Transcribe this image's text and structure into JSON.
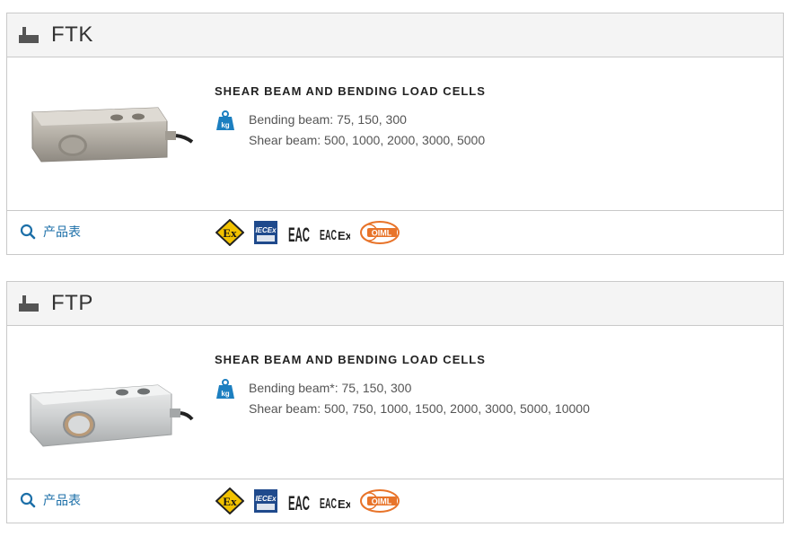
{
  "products": [
    {
      "code": "FTK",
      "category": "SHEAR BEAM AND BENDING LOAD CELLS",
      "unit_icon_label": "kg",
      "specs": [
        "Bending beam: 75, 150, 300",
        "Shear beam: 500, 1000, 2000, 3000, 5000"
      ],
      "datasheet_label": "产品表",
      "certifications": [
        {
          "icon": "atex-ex-icon",
          "label": "Ex"
        },
        {
          "icon": "iecex-icon",
          "label": "IECEx"
        },
        {
          "icon": "eac-icon",
          "label": "EAC"
        },
        {
          "icon": "eac-ex-icon",
          "label": "EAC Ex"
        },
        {
          "icon": "oiml-icon",
          "label": "OIML"
        }
      ]
    },
    {
      "code": "FTP",
      "category": "SHEAR BEAM AND BENDING LOAD CELLS",
      "unit_icon_label": "kg",
      "specs": [
        "Bending beam*: 75, 150, 300",
        "Shear beam: 500, 750, 1000, 1500, 2000, 3000, 5000, 10000"
      ],
      "datasheet_label": "产品表",
      "certifications": [
        {
          "icon": "atex-ex-icon",
          "label": "Ex"
        },
        {
          "icon": "iecex-icon",
          "label": "IECEx"
        },
        {
          "icon": "eac-icon",
          "label": "EAC"
        },
        {
          "icon": "eac-ex-icon",
          "label": "EAC Ex"
        },
        {
          "icon": "oiml-icon",
          "label": "OIML"
        }
      ]
    }
  ],
  "colors": {
    "link": "#1c6fa8",
    "ex_yellow": "#f2c200",
    "iecex_blue": "#1f4a8c",
    "oiml_orange": "#e8742a",
    "kg_blue": "#1c7fc0"
  }
}
